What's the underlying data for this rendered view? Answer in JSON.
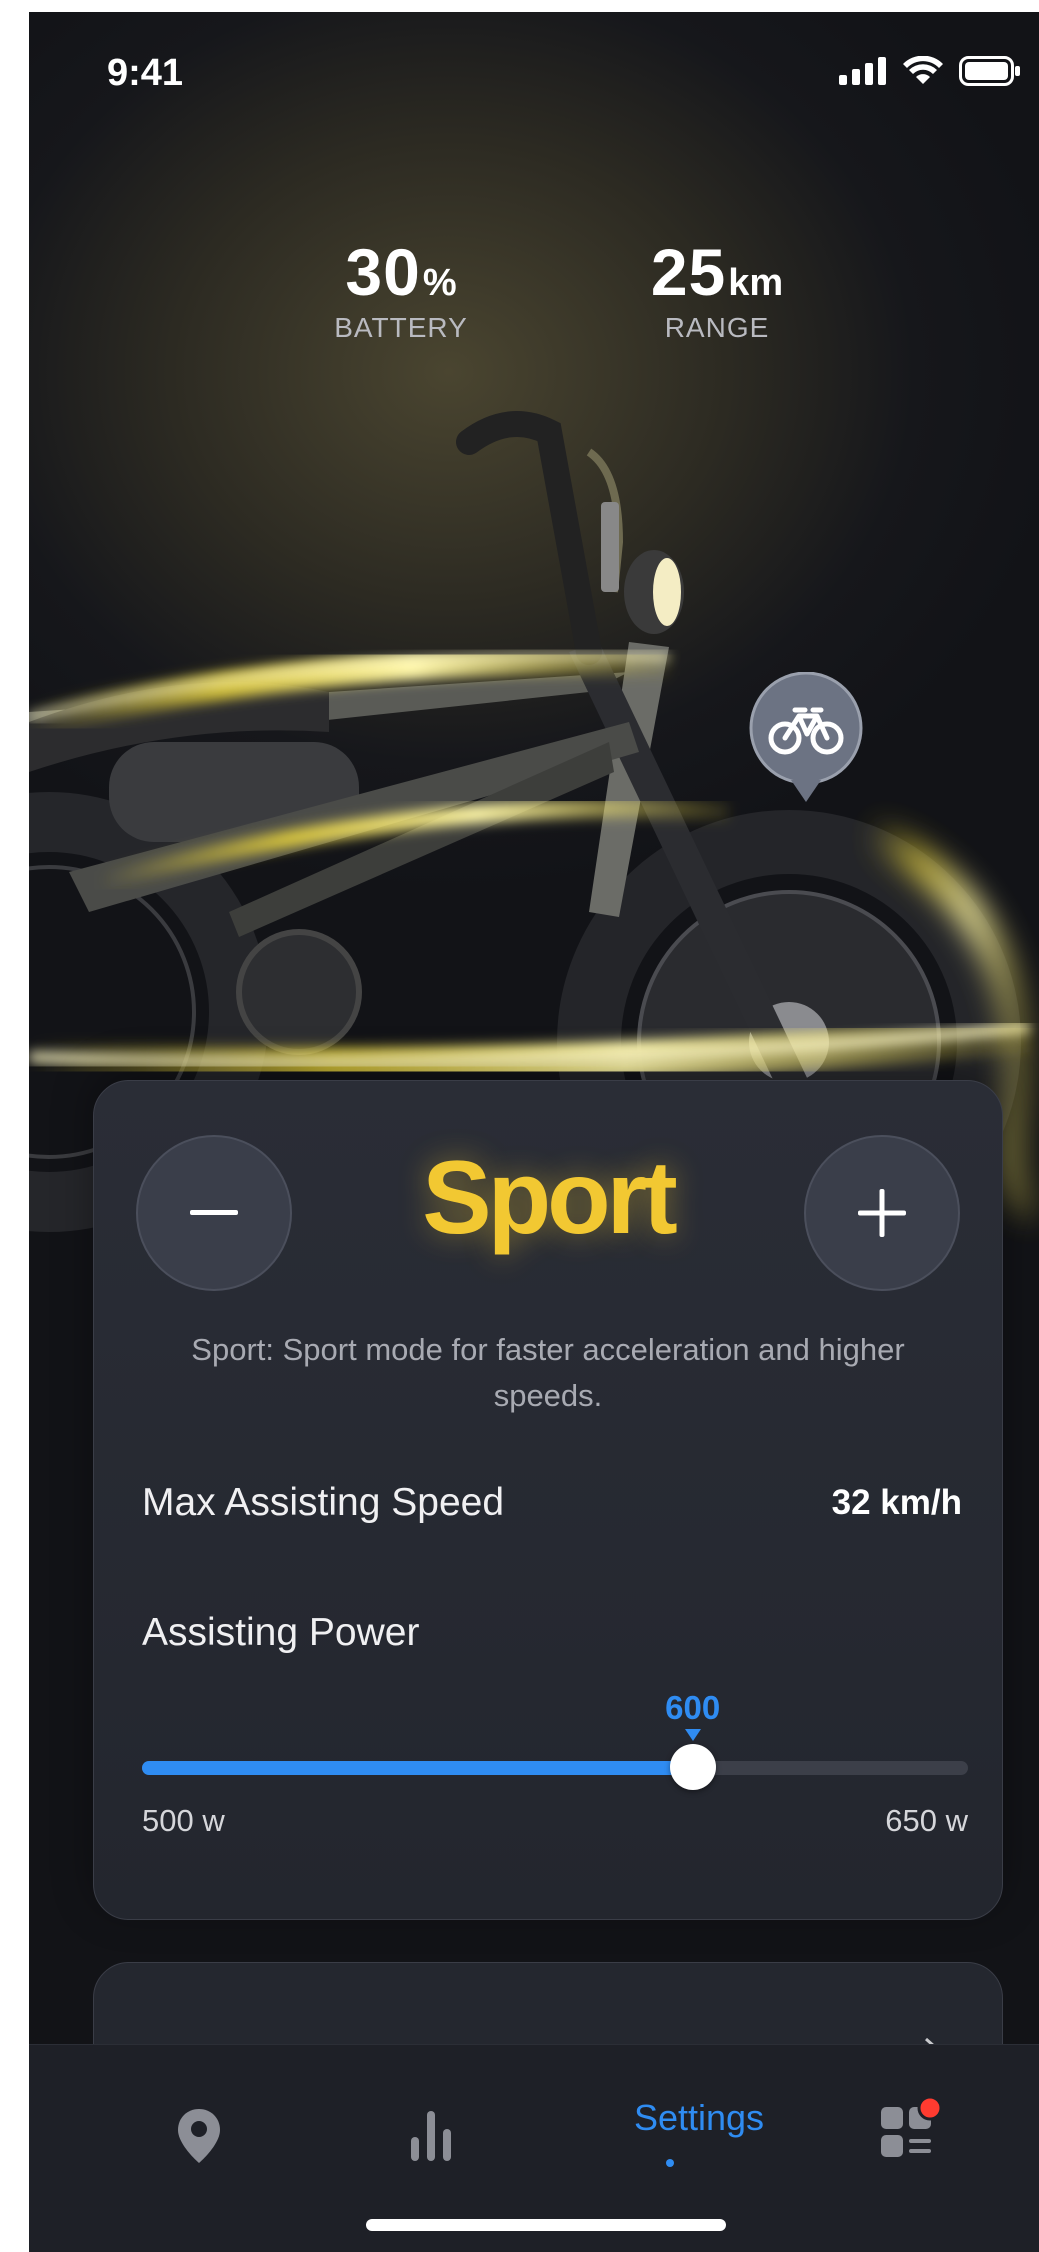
{
  "status_bar": {
    "time": "9:41"
  },
  "stats": {
    "battery": {
      "value": "30",
      "unit": "%",
      "label": "BATTERY"
    },
    "range": {
      "value": "25",
      "unit": "km",
      "label": "RANGE"
    }
  },
  "mode_card": {
    "minus_icon": "minus-icon",
    "plus_icon": "plus-icon",
    "mode_name": "Sport",
    "description": "Sport: Sport mode for faster acceleration and higher speeds.",
    "max_speed_label": "Max Assisting Speed",
    "max_speed_value": "32 km/h",
    "power_label": "Assisting Power",
    "power_value": "600",
    "power_min_label": "500 w",
    "power_max_label": "650 w",
    "power_min": 500,
    "power_max": 650,
    "power_current": 600
  },
  "tab_bar": {
    "tabs": [
      {
        "name": "map",
        "icon": "location-pin-icon"
      },
      {
        "name": "stats",
        "icon": "bar-chart-icon"
      },
      {
        "name": "settings",
        "label": "Settings",
        "active": true
      },
      {
        "name": "apps",
        "icon": "apps-grid-icon",
        "badge": true
      }
    ]
  },
  "colors": {
    "accent_blue": "#2f8cf2",
    "mode_yellow": "#f2c832",
    "badge_red": "#ff3b30"
  }
}
